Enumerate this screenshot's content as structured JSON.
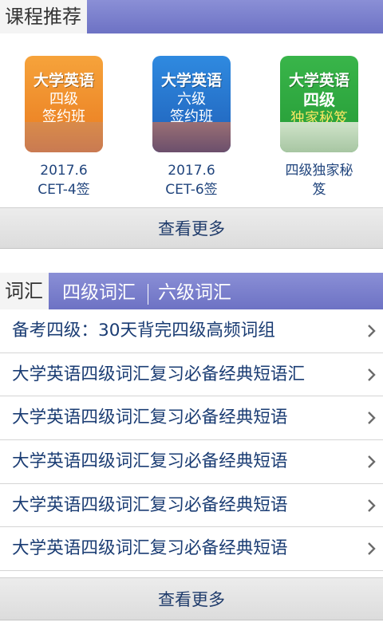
{
  "courses_section": {
    "title": "课程推荐",
    "items": [
      {
        "cover_line1": "大学英语",
        "cover_line2": "四级",
        "cover_line3": "签约班",
        "caption_line1": "2017.6",
        "caption_line2": "CET-4签"
      },
      {
        "cover_line1": "大学英语",
        "cover_line2": "六级",
        "cover_line3": "签约班",
        "caption_line1": "2017.6",
        "caption_line2": "CET-6签"
      },
      {
        "cover_line1": "大学英语",
        "cover_line2": "四级",
        "cover_line3": "独家秘笈",
        "caption_line1": "四级独家秘",
        "caption_line2": "笈"
      }
    ],
    "more_label": "查看更多"
  },
  "vocab_section": {
    "active_tab": "词汇",
    "tabs": [
      "四级词汇",
      "六级词汇"
    ],
    "rows": [
      "备考四级：30天背完四级高频词组",
      "大学英语四级词汇复习必备经典短语汇",
      "大学英语四级词汇复习必备经典短语",
      "大学英语四级词汇复习必备经典短语",
      "大学英语四级词汇复习必备经典短语",
      "大学英语四级词汇复习必备经典短语"
    ],
    "more_label": "查看更多"
  },
  "colors": {
    "header_bar": "#7b80cc",
    "text": "#1f3b6b",
    "cover_orange": "#f39a33",
    "cover_blue": "#2a7fd6",
    "cover_green": "#34b046"
  },
  "icons": {
    "row_arrow": "chevron-right-icon"
  }
}
